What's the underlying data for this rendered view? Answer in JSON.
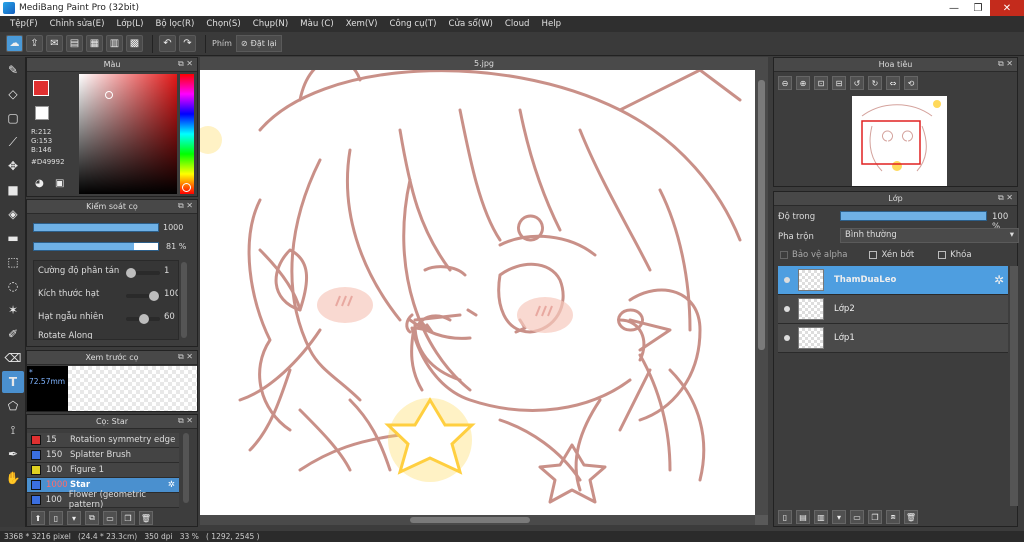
{
  "window": {
    "title": "MediBang Paint Pro (32bit)",
    "minimize": "—",
    "maximize": "❐",
    "close": "✕"
  },
  "menu": [
    "Tệp(F)",
    "Chỉnh sửa(E)",
    "Lớp(L)",
    "Bộ lọc(R)",
    "Chọn(S)",
    "Chụp(N)",
    "Màu (C)",
    "Xem(V)",
    "Công cụ(T)",
    "Cửa sổ(W)",
    "Cloud",
    "Help"
  ],
  "toolbar": {
    "key_label": "Phím",
    "reset_label": "Đặt lại"
  },
  "color_panel": {
    "title": "Màu",
    "r": "R:212",
    "g": "G:153",
    "b": "B:146",
    "hex": "#D49992",
    "current_color": "#d49992"
  },
  "brush_control": {
    "title": "Kiểm soát cọ",
    "size_value": "1000",
    "opacity_value": "81 %",
    "opacity_fraction": 0.81,
    "params": [
      {
        "label": "Cường độ phân tán",
        "value": "1",
        "level": 0.12
      },
      {
        "label": "Kích thước hạt",
        "value": "100",
        "level": 0.9
      },
      {
        "label": "Hạt ngẫu nhiên",
        "value": "60",
        "level": 0.55
      }
    ],
    "last_param": "Rotate Along"
  },
  "brush_preview": {
    "title": "Xem trước cọ",
    "size": "72.57mm"
  },
  "brush_list": {
    "title": "Cọ: Star",
    "items": [
      {
        "num": "15",
        "name": "Rotation symmetry edge",
        "color": "#e03030"
      },
      {
        "num": "150",
        "name": "Splatter Brush",
        "color": "#3a6ee0"
      },
      {
        "num": "100",
        "name": "Figure 1",
        "color": "#e0d020"
      },
      {
        "num": "1000",
        "name": "Star",
        "color": "#3a6ee0"
      },
      {
        "num": "100",
        "name": "Flower (geometric pattern)",
        "color": "#3a6ee0"
      }
    ]
  },
  "document": {
    "tab": "5.jpg"
  },
  "navigator": {
    "title": "Hoa tiêu"
  },
  "layers": {
    "title": "Lớp",
    "opacity_label": "Độ trong",
    "opacity_value": "100 %",
    "opacity_fraction": 1.0,
    "blend_label": "Pha trộn",
    "blend_value": "Bình thường",
    "alpha_lock": "Bảo vệ alpha",
    "clipping": "Xén bớt",
    "lock": "Khóa",
    "items": [
      {
        "name": "ThamDuaLeo"
      },
      {
        "name": "Lớp2"
      },
      {
        "name": "Lớp1"
      }
    ]
  },
  "status": {
    "text": "3368 * 3216 pixel   (24.4 * 23.3cm)   350 dpi   33 %   ( 1292, 2545 )"
  }
}
